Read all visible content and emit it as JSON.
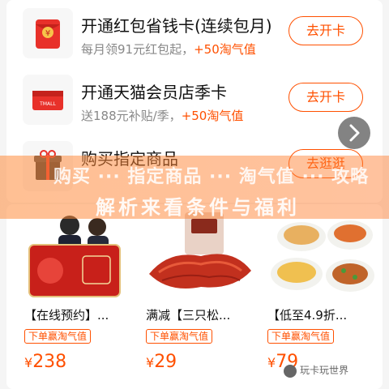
{
  "tasks": [
    {
      "title": "开通红包省钱卡(连续包月)",
      "sub_plain": "每月领91元红包起，",
      "sub_accent": "+50淘气值",
      "button": "去开卡",
      "icon": "red-envelope-icon"
    },
    {
      "title": "开通天猫会员店季卡",
      "sub_plain": "送188元补贴/季，",
      "sub_accent": "+50淘气值",
      "button": "去开卡",
      "icon": "tmall-card-icon"
    },
    {
      "title": "购买指定商品",
      "sub_plain": "",
      "sub_accent": "",
      "button": "去逛逛",
      "icon": "gift-box-icon"
    }
  ],
  "overlay": {
    "line1": "购买 ··· 指定商品 ··· 淘气值 ··· 攻略",
    "line2": "解析来看条件与福利"
  },
  "products": [
    {
      "title": "【在线预约】...",
      "tag": "下单赢淘气值",
      "currency": "¥",
      "price": "238",
      "image": "health-checkup-card-image"
    },
    {
      "title": "满减【三只松...",
      "tag": "下单赢淘气值",
      "currency": "¥",
      "price": "29",
      "image": "beef-jerky-image"
    },
    {
      "title": "【低至4.9折...",
      "tag": "下单赢淘气值",
      "currency": "¥",
      "price": "79",
      "image": "food-dishes-image"
    }
  ],
  "watermark": "玩卡玩世界",
  "colors": {
    "accent": "#ff5000",
    "background": "#f5f5f5"
  }
}
